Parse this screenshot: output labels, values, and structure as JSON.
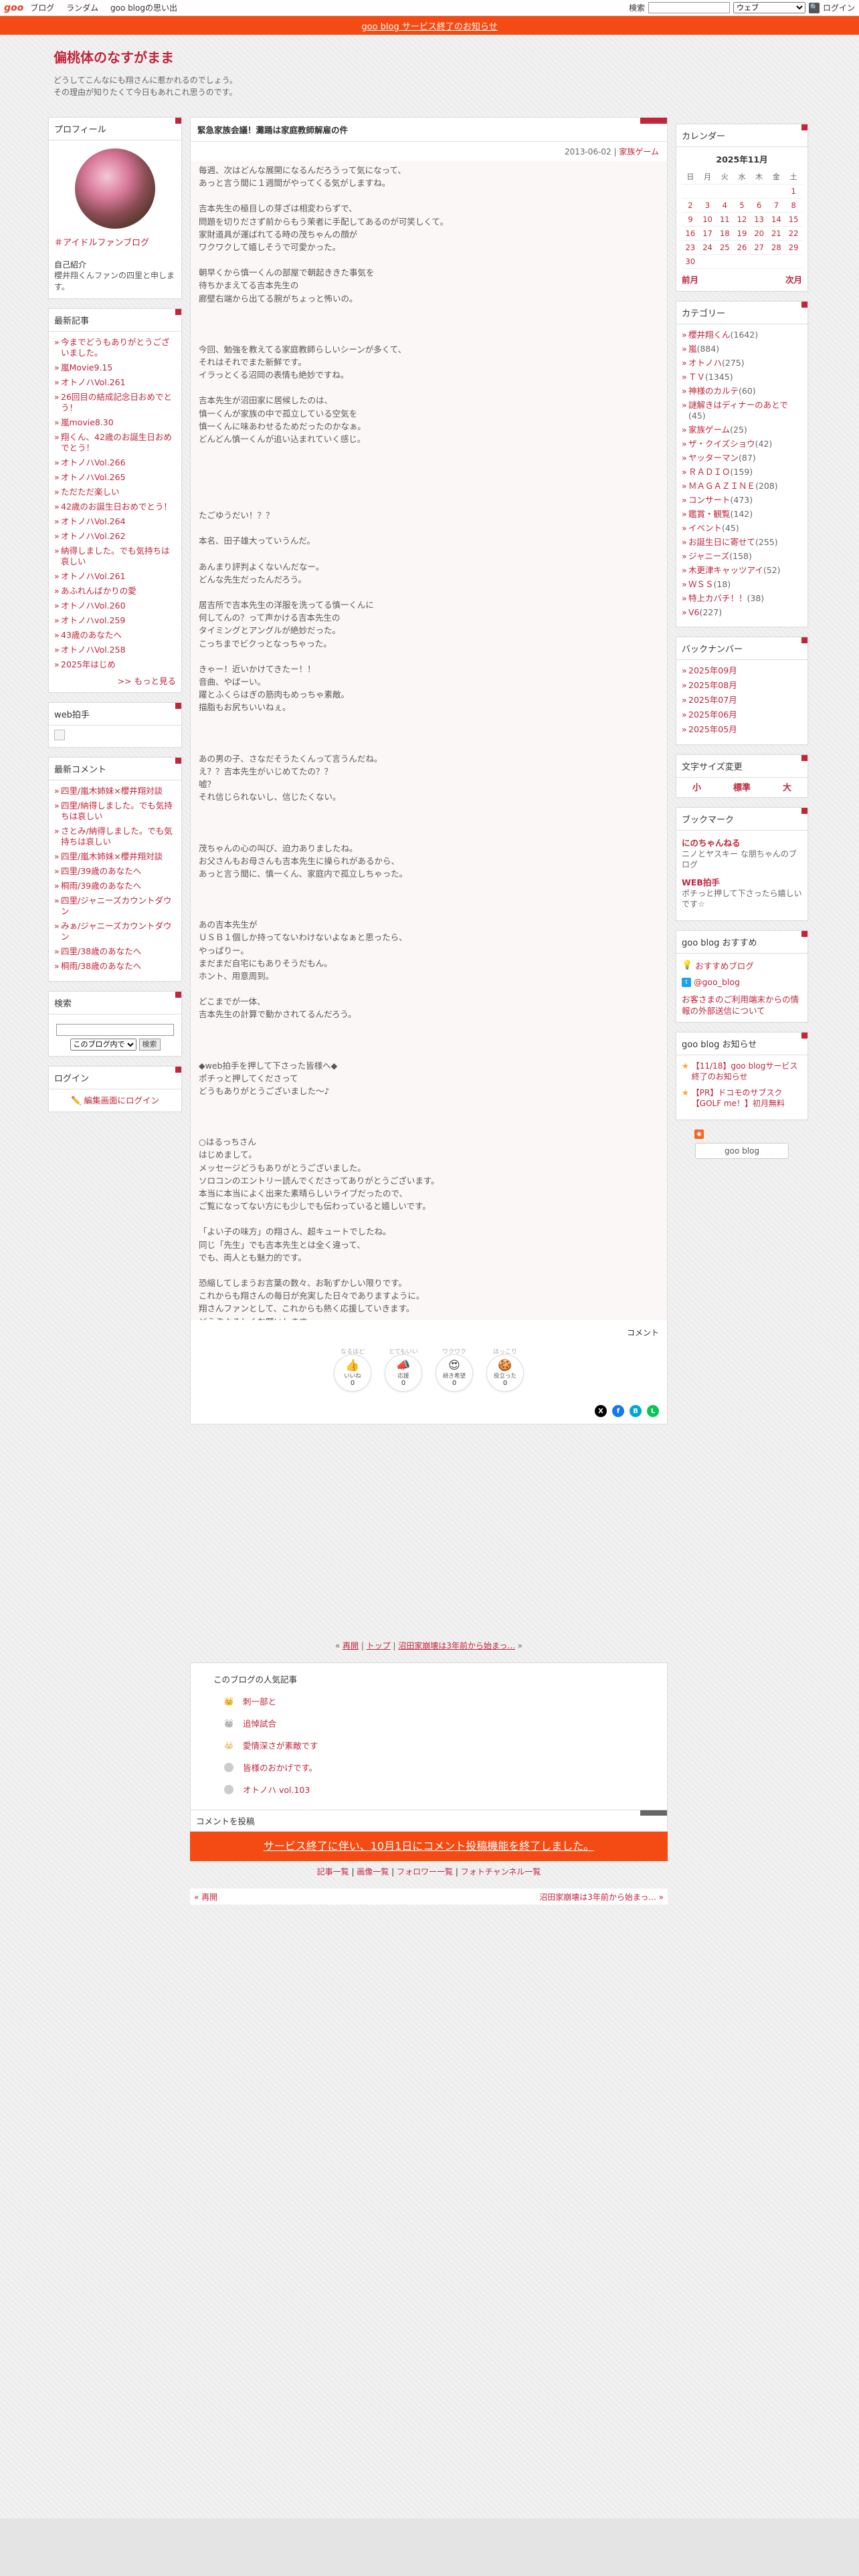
{
  "topbar": {
    "logo": "goo",
    "links": [
      "ブログ",
      "ランダム",
      "goo blogの思い出"
    ],
    "search_label": "検索",
    "search_scope": "ウェブ",
    "search_icon": "magnifier-icon",
    "login": "ログイン"
  },
  "notice": "goo blog サービス終了のお知らせ",
  "blog": {
    "title": "偏桃体のなすがまま",
    "desc_line1": "どうしてこんなにも翔さんに惹かれるのでしょう。",
    "desc_line2": "その理由が知りたくて今日もあれこれ思うのです。"
  },
  "profile": {
    "heading": "プロフィール",
    "link": "＃アイドルファンブログ",
    "intro_label": "自己紹介",
    "intro": "櫻井翔くんファンの四里と申します。"
  },
  "recent_articles": {
    "heading": "最新記事",
    "items": [
      "今までどうもありがとうございました。",
      "嵐Movie9.15",
      "オトノハVol.261",
      "26回目の結成記念日おめでとう！",
      "嵐movie8.30",
      "翔くん、42歳のお誕生日おめでとう！",
      "オトノハVol.266",
      "オトノハVol.265",
      "ただただ楽しい",
      "42歳のお誕生日おめでとう！",
      "オトノハVol.264",
      "オトノハVol.262",
      "納得しました。でも気持ちは哀しい",
      "オトノハVol.261",
      "あふれんばかりの愛",
      "オトノハVol.260",
      "オトノハvol.259",
      "43歳のあなたへ",
      "オトノハVol.258",
      "2025年はじめ"
    ],
    "more": ">> もっと見る"
  },
  "web_clap": {
    "heading": "web拍手"
  },
  "recent_comments": {
    "heading": "最新コメント",
    "items": [
      "四里/嵐木姉妹×櫻井翔対談",
      "四里/納得しました。でも気持ちは哀しい",
      "さとみ/納得しました。でも気持ちは哀しい",
      "四里/嵐木姉妹×櫻井翔対談",
      "四里/39歳のあなたへ",
      "桐雨/39歳のあなたへ",
      "四里/ジャニーズカウントダウン",
      "みぁ/ジャニーズカウントダウン",
      "四里/38歳のあなたへ",
      "桐雨/38歳のあなたへ"
    ]
  },
  "search_widget": {
    "heading": "検索",
    "scope": "このブログ内で",
    "button": "検索"
  },
  "login_widget": {
    "heading": "ログイン",
    "link": "編集画面にログイン"
  },
  "article": {
    "title": "緊急家族会議！灘踊は家庭教師解雇の件",
    "date": "2013-06-02",
    "category": "家族ゲーム",
    "paragraphs": [
      "毎週、次はどんな展開になるんだろうって気になって、\nあっと言う間に１週間がやってくる気がしますね。",
      "吉本先生の極目しの芽ざは相変わらずで、\n問題を切りださず前からもう茉者に手配してあるのが可笑しくて。\n家財道具が運ばれてる時の茂ちゃんの顔が\nワクワクして嬉しそうで可愛かった。",
      "朝早くから慎一くんの部屋で朝起ききた事気を\n待ちかまえてる吉本先生の\n廊壁右端から出てる腕がちょっと怖いの。",
      "",
      "今回、勉強を教えてる家庭教師らしいシーンが多くて、\nそれはそれでまた新鮮です。\nイラっとくる沼岡の表情も絶妙ですね。",
      "吉本先生が沼田家に居候したのは、\n慎一くんが家族の中で孤立している空気を\n慎一くんに味あわせるためだったのかなぁ。\nどんどん慎一くんが追い込まれていく感じ。",
      "",
      "",
      "たごゆうだい！？？",
      "本名、田子雄大っていうんだ。",
      "あんまり評判よくないんだなー。\nどんな先生だったんだろう。",
      "居吉所で吉本先生の洋服を洗ってる慎一くんに\n何してんの？って声かける吉本先生の\nタイミングとアングルが絶妙だった。\nこっちまでビクっとなっちゃった。",
      "きゃー！近いかけてきたー！！\n音曲、やばーい。\n躍とふくらはぎの筋肉もめっちゃ素敵。\n描脂もお尻ちいいねぇ。",
      "",
      "あの男の子、さなだそうたくんって言うんだね。\nえ？？吉本先生がいじめてたの？？\n嘘？\nそれ信じられないし、信じたくない。",
      "",
      "茂ちゃんの心の叫び、迫力ありましたね。\nお父さんもお母さんも吉本先生に操られがあるから、\nあっと言う間に、慎一くん、家庭内で孤立しちゃった。",
      "",
      "あの吉本先生が\nＵＳＢ１個しか持ってないわけないよなぁと思ったら、\nやっぱりー。\nまだまだ自宅にもありそうだもん。\nホント、用意周到。",
      "どこまでが一体、\n吉本先生の計算で動かされてるんだろう。",
      "",
      "◆web拍手を押して下さった皆様へ◆\nポチっと押してくださって\nどうもありがとうございました～♪",
      "",
      "○はるっちさん\nはじめまして。\nメッセージどうもありがとうございました。\nソロコンのエントリー読んでくださってありがとうございます。\n本当に本当によく出来た素晴らしいライブだったので、\nご覧になってない方にも少しでも伝わっていると嬉しいです。",
      "「よい子の味方」の翔さん、超キュートでしたね。\n同じ「先生」でも吉本先生とは全く違って、\nでも、両人とも魅力的です。",
      "恐縮してしまうお言葉の数々、お恥ずかしい限りです。\nこれからも翔さんの毎日が充実した日々でありますように。\n翔さんファンとして、これからも熱く応援していきます。\nどうぞよろしくお願いします。"
    ],
    "comment_link": "コメント",
    "reactions": [
      {
        "top": "なるほど",
        "icon": "👍",
        "label": "いいね",
        "count": "0"
      },
      {
        "top": "とてもいい",
        "icon": "📣",
        "label": "応援",
        "count": "0"
      },
      {
        "top": "ワクワク",
        "icon": "😍",
        "label": "続き希望",
        "count": "0"
      },
      {
        "top": "ほっこり",
        "icon": "🍪",
        "label": "役立った",
        "count": "0"
      }
    ]
  },
  "pager": {
    "prev": "再開",
    "top": "トップ",
    "next": "沼田家崩壊は3年前から始まっ..."
  },
  "popular": {
    "heading": "このブログの人気記事",
    "items": [
      "刺一部と",
      "追悼試合",
      "愛情深さが素敵です",
      "皆様のおかげです。",
      "オトノハ vol.103"
    ]
  },
  "comment_post": {
    "heading": "コメントを投稿",
    "ended": "サービス終了に伴い、10月1日にコメント投稿機能を終了しました。"
  },
  "bottom_links": [
    "記事一覧",
    "画像一覧",
    "フォロワー一覧",
    "フォトチャンネル一覧"
  ],
  "bottom_nav": {
    "prev": "« 再開",
    "next": "沼田家崩壊は3年前から始まっ... »"
  },
  "calendar": {
    "heading": "カレンダー",
    "title": "2025年11月",
    "weekdays": [
      "日",
      "月",
      "火",
      "水",
      "木",
      "金",
      "土"
    ],
    "weeks": [
      [
        "",
        "",
        "",
        "",
        "",
        "",
        "1"
      ],
      [
        "2",
        "3",
        "4",
        "5",
        "6",
        "7",
        "8"
      ],
      [
        "9",
        "10",
        "11",
        "12",
        "13",
        "14",
        "15"
      ],
      [
        "16",
        "17",
        "18",
        "19",
        "20",
        "21",
        "22"
      ],
      [
        "23",
        "24",
        "25",
        "26",
        "27",
        "28",
        "29"
      ],
      [
        "30",
        "",
        "",
        "",
        "",
        "",
        ""
      ]
    ],
    "prev": "前月",
    "next": "次月"
  },
  "categories": {
    "heading": "カテゴリー",
    "items": [
      {
        "name": "櫻井翔くん",
        "count": "(1642)"
      },
      {
        "name": "嵐",
        "count": "(884)"
      },
      {
        "name": "オトノハ",
        "count": "(275)"
      },
      {
        "name": "ＴＶ",
        "count": "(1345)"
      },
      {
        "name": "神様のカルテ",
        "count": "(60)"
      },
      {
        "name": "謎解きはディナーのあとで",
        "count": "(45)"
      },
      {
        "name": "家族ゲーム",
        "count": "(25)"
      },
      {
        "name": "ザ・クイズショウ",
        "count": "(42)"
      },
      {
        "name": "ヤッターマン",
        "count": "(87)"
      },
      {
        "name": "ＲＡＤＩＯ",
        "count": "(159)"
      },
      {
        "name": "ＭＡＧＡＺＩＮＥ",
        "count": "(208)"
      },
      {
        "name": "コンサート",
        "count": "(473)"
      },
      {
        "name": "鑑賞・観覧",
        "count": "(142)"
      },
      {
        "name": "イベント",
        "count": "(45)"
      },
      {
        "name": "お誕生日に寄せて",
        "count": "(255)"
      },
      {
        "name": "ジャニーズ",
        "count": "(158)"
      },
      {
        "name": "木更津キャッツアイ",
        "count": "(52)"
      },
      {
        "name": "ＷＳＳ",
        "count": "(18)"
      },
      {
        "name": "特上カバチ！！",
        "count": "(38)"
      },
      {
        "name": "V6",
        "count": "(227)"
      }
    ]
  },
  "backnumber": {
    "heading": "バックナンバー",
    "items": [
      "2025年09月",
      "2025年08月",
      "2025年07月",
      "2025年06月",
      "2025年05月"
    ]
  },
  "font_size": {
    "heading": "文字サイズ変更",
    "small": "小",
    "medium": "標準",
    "large": "大"
  },
  "bookmark": {
    "heading": "ブックマーク",
    "items": [
      {
        "title": "にのちゃんねる",
        "desc": "ニノとヤスキー な朋ちゃんのブログ"
      },
      {
        "title": "WEB拍手",
        "desc": "ポチっと押して下さったら嬉しいです☆"
      }
    ]
  },
  "goo_recommend": {
    "heading": "goo blog おすすめ",
    "items": [
      "おすすめブログ",
      "@goo_blog"
    ],
    "note": "お客さまのご利用端末からの情報の外部送信について"
  },
  "goo_news": {
    "heading": "goo blog お知らせ",
    "items": [
      "【11/18】goo blogサービス終了のお知らせ",
      "【PR】ドコモのサブスク【GOLF me！】初月無料"
    ]
  },
  "badge": "goo blog",
  "colors": {
    "accent": "#c2243a",
    "notice": "#f44a13"
  }
}
